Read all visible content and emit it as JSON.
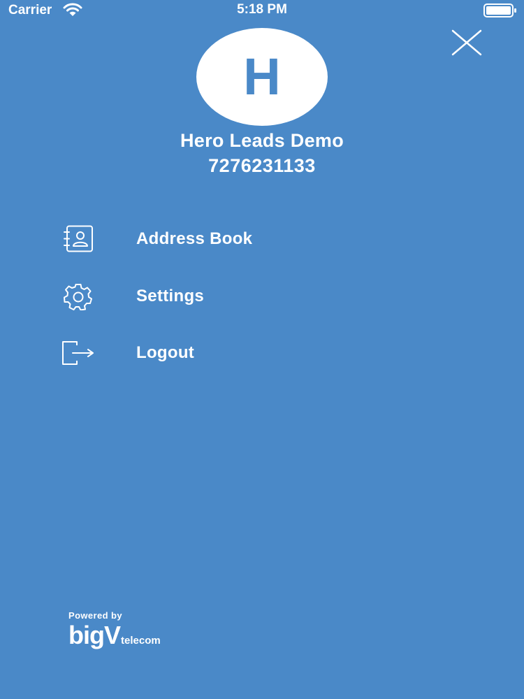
{
  "status_bar": {
    "carrier": "Carrier",
    "time": "5:18 PM",
    "icons": [
      "wifi-icon",
      "battery-icon"
    ]
  },
  "drawer": {
    "close_icon": "close-icon"
  },
  "profile": {
    "avatar_initial": "H",
    "name": "Hero Leads Demo",
    "phone": "7276231133"
  },
  "menu": {
    "items": [
      {
        "label": "Address Book",
        "icon": "address-book-icon"
      },
      {
        "label": "Settings",
        "icon": "gear-icon"
      },
      {
        "label": "Logout",
        "icon": "logout-icon"
      }
    ]
  },
  "footer": {
    "powered_by": "Powered by",
    "brand_main": "bigV",
    "brand_sub": "telecom"
  },
  "colors": {
    "background": "#4a89c8",
    "foreground": "#ffffff"
  }
}
